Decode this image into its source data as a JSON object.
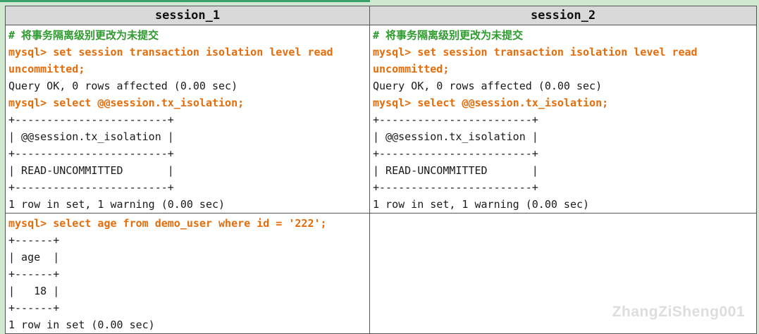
{
  "headers": {
    "session1": "session_1",
    "session2": "session_2"
  },
  "session1_block1": [
    {
      "type": "comment",
      "text": "# 将事务隔离级别更改为未提交"
    },
    {
      "type": "command",
      "text": "mysql> set session transaction isolation level read"
    },
    {
      "type": "command",
      "text": "uncommitted;"
    },
    {
      "type": "output",
      "text": "Query OK, 0 rows affected (0.00 sec)"
    },
    {
      "type": "command",
      "text": "mysql> select @@session.tx_isolation;"
    },
    {
      "type": "output",
      "text": "+------------------------+"
    },
    {
      "type": "output",
      "text": "| @@session.tx_isolation |"
    },
    {
      "type": "output",
      "text": "+------------------------+"
    },
    {
      "type": "output",
      "text": "| READ-UNCOMMITTED       |"
    },
    {
      "type": "output",
      "text": "+------------------------+"
    },
    {
      "type": "output",
      "text": "1 row in set, 1 warning (0.00 sec)"
    }
  ],
  "session2_block1": [
    {
      "type": "comment",
      "text": "# 将事务隔离级别更改为未提交"
    },
    {
      "type": "command",
      "text": "mysql> set session transaction isolation level read"
    },
    {
      "type": "command",
      "text": "uncommitted;"
    },
    {
      "type": "output",
      "text": "Query OK, 0 rows affected (0.00 sec)"
    },
    {
      "type": "command",
      "text": "mysql> select @@session.tx_isolation;"
    },
    {
      "type": "output",
      "text": "+------------------------+"
    },
    {
      "type": "output",
      "text": "| @@session.tx_isolation |"
    },
    {
      "type": "output",
      "text": "+------------------------+"
    },
    {
      "type": "output",
      "text": "| READ-UNCOMMITTED       |"
    },
    {
      "type": "output",
      "text": "+------------------------+"
    },
    {
      "type": "output",
      "text": "1 row in set, 1 warning (0.00 sec)"
    }
  ],
  "session1_block2": [
    {
      "type": "command",
      "text": "mysql> select age from demo_user where id = '222';"
    },
    {
      "type": "output",
      "text": "+------+"
    },
    {
      "type": "output",
      "text": "| age  |"
    },
    {
      "type": "output",
      "text": "+------+"
    },
    {
      "type": "output",
      "text": "|   18 |"
    },
    {
      "type": "output",
      "text": "+------+"
    },
    {
      "type": "output",
      "text": "1 row in set (0.00 sec)"
    }
  ],
  "session2_block2": [],
  "watermark": "ZhangZiSheng001",
  "colors": {
    "comment": "#2f9b2f",
    "command": "#e46c0a",
    "output": "#1a1a1a",
    "header_bg": "#d9d9d9",
    "page_bg": "#cfe8cf"
  }
}
